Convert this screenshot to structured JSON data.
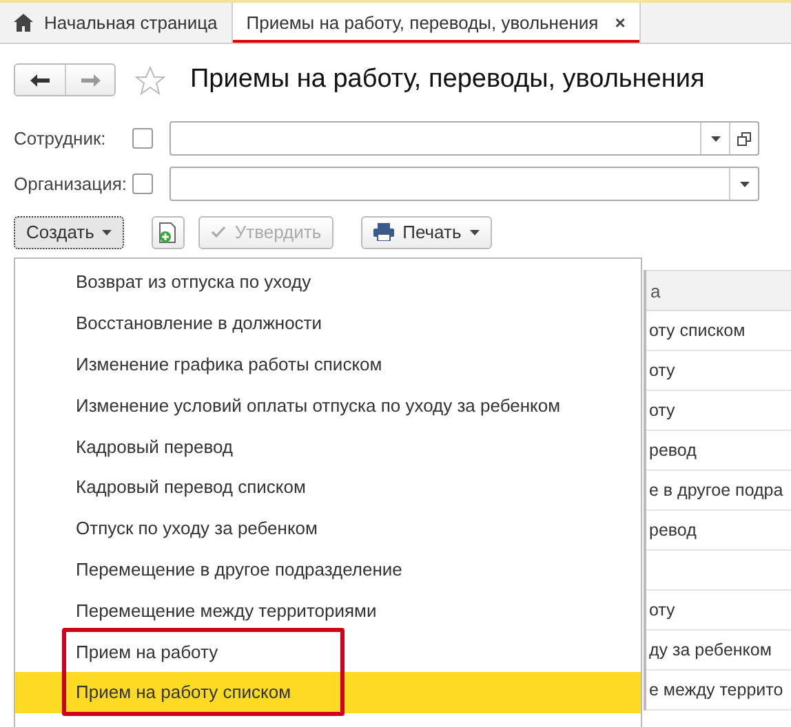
{
  "tabs": [
    {
      "label": "Начальная страница",
      "kind": "home",
      "selected": false
    },
    {
      "label": "Приемы на работу, переводы, увольнения",
      "kind": "doc",
      "selected": true,
      "close": "×"
    }
  ],
  "header": {
    "title": "Приемы на работу, переводы, увольнения",
    "favorite": false
  },
  "filters": [
    {
      "label": "Сотрудник:",
      "checked": false,
      "open_button": true
    },
    {
      "label": "Организация:",
      "checked": false,
      "open_button": false
    }
  ],
  "toolbar": {
    "create": "Создать",
    "approve": {
      "label": "Утвердить",
      "disabled": true
    },
    "print": "Печать"
  },
  "table": {
    "header": "а",
    "rows": [
      {
        "text": "оту списком"
      },
      {
        "text": "оту"
      },
      {
        "text": "оту"
      },
      {
        "text": "ревод"
      },
      {
        "text": "е в другое подра"
      },
      {
        "text": "ревод"
      },
      {},
      {
        "text": "оту"
      },
      {
        "text": "ду за ребенком"
      },
      {
        "text": "е между террито"
      }
    ]
  },
  "menu": {
    "items": [
      {
        "label": "Возврат из отпуска по уходу",
        "selected": false,
        "highlighted": false
      },
      {
        "label": "Восстановление в должности",
        "selected": false,
        "highlighted": false
      },
      {
        "label": "Изменение графика работы списком",
        "selected": false,
        "highlighted": false
      },
      {
        "label": "Изменение условий оплаты отпуска по уходу за ребенком",
        "selected": false,
        "highlighted": false
      },
      {
        "label": "Кадровый перевод",
        "selected": false,
        "highlighted": false
      },
      {
        "label": "Кадровый перевод списком",
        "selected": false,
        "highlighted": false
      },
      {
        "label": "Отпуск по уходу за ребенком",
        "selected": false,
        "highlighted": false
      },
      {
        "label": "Перемещение в другое подразделение",
        "selected": false,
        "highlighted": false
      },
      {
        "label": "Перемещение между территориями",
        "selected": false,
        "highlighted": false
      },
      {
        "label": "Прием на работу",
        "selected": false,
        "highlighted": true
      },
      {
        "label": "Прием на работу списком",
        "selected": true,
        "highlighted": true
      }
    ]
  }
}
